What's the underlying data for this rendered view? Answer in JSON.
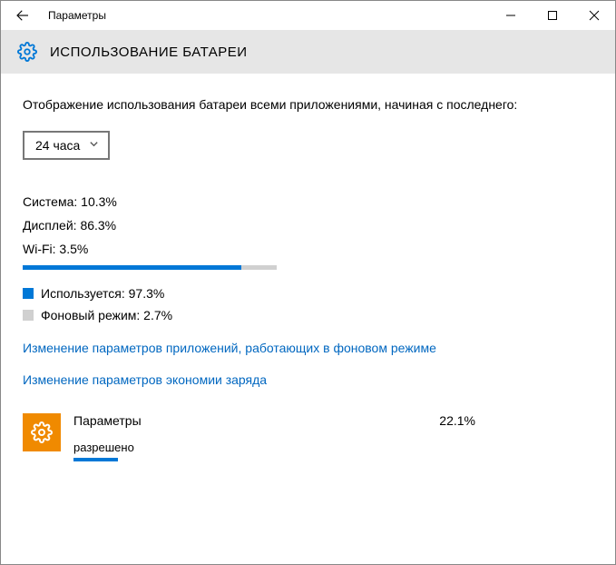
{
  "window": {
    "title": "Параметры"
  },
  "header": {
    "page_title": "ИСПОЛЬЗОВАНИЕ БАТАРЕИ"
  },
  "description": "Отображение использования батареи всеми приложениями, начиная с последнего:",
  "period_select": {
    "value": "24 часа"
  },
  "system_stats": {
    "system": "Система: 10.3%",
    "display": "Дисплей: 86.3%",
    "wifi": "Wi-Fi: 3.5%",
    "bar_percent": 86
  },
  "usage_legend": {
    "in_use": "Используется: 97.3%",
    "background": "Фоновый режим: 2.7%"
  },
  "links": {
    "bg_apps": "Изменение параметров приложений, работающих в фоновом режиме",
    "battery_saver": "Изменение параметров экономии заряда"
  },
  "app": {
    "name": "Параметры",
    "percent": "22.1%",
    "status": "разрешено",
    "bar_percent": 12
  }
}
